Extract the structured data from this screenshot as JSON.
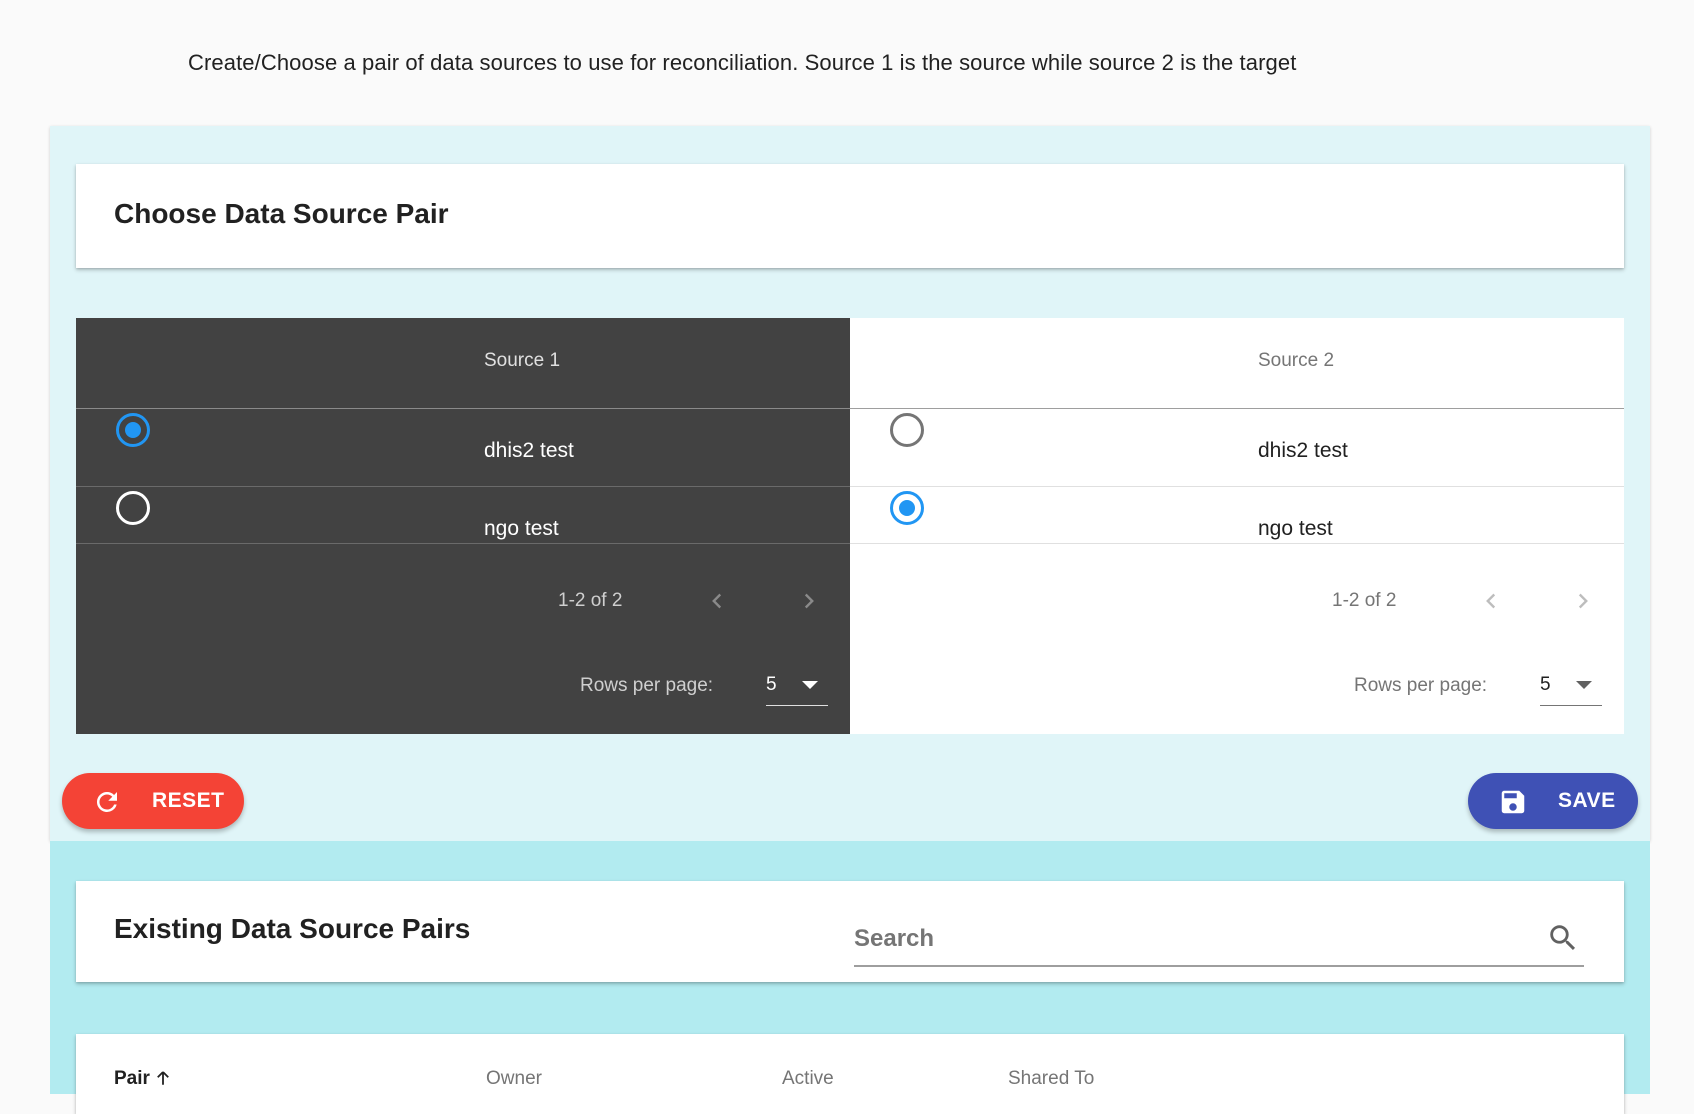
{
  "instructions": "Create/Choose a pair of data sources to use for reconciliation. Source 1 is the source while source 2 is the target",
  "choose_card": {
    "title": "Choose Data Source Pair"
  },
  "source1": {
    "header": "Source 1",
    "rows": [
      {
        "label": "dhis2 test",
        "selected": true
      },
      {
        "label": "ngo test",
        "selected": false
      }
    ],
    "pagination": "1-2 of 2",
    "rows_per_page_label": "Rows per page:",
    "rows_per_page": "5"
  },
  "source2": {
    "header": "Source 2",
    "rows": [
      {
        "label": "dhis2 test",
        "selected": false
      },
      {
        "label": "ngo test",
        "selected": true
      }
    ],
    "pagination": "1-2 of 2",
    "rows_per_page_label": "Rows per page:",
    "rows_per_page": "5"
  },
  "buttons": {
    "reset": {
      "label": "RESET",
      "icon": "refresh-icon",
      "color": "#f44336"
    },
    "save": {
      "label": "SAVE",
      "icon": "floppy-disk-icon",
      "color": "#3f51b5"
    }
  },
  "existing_card": {
    "title": "Existing Data Source Pairs",
    "search_placeholder": "Search"
  },
  "pairs_table": {
    "columns": [
      "Pair",
      "Owner",
      "Active",
      "Shared To"
    ],
    "sort": "ascending"
  },
  "colors": {
    "accent_radio": "#2196f3",
    "panel_top": "#e0f5f8",
    "panel_bottom": "#b2ebf0",
    "dark_table": "#424242"
  }
}
